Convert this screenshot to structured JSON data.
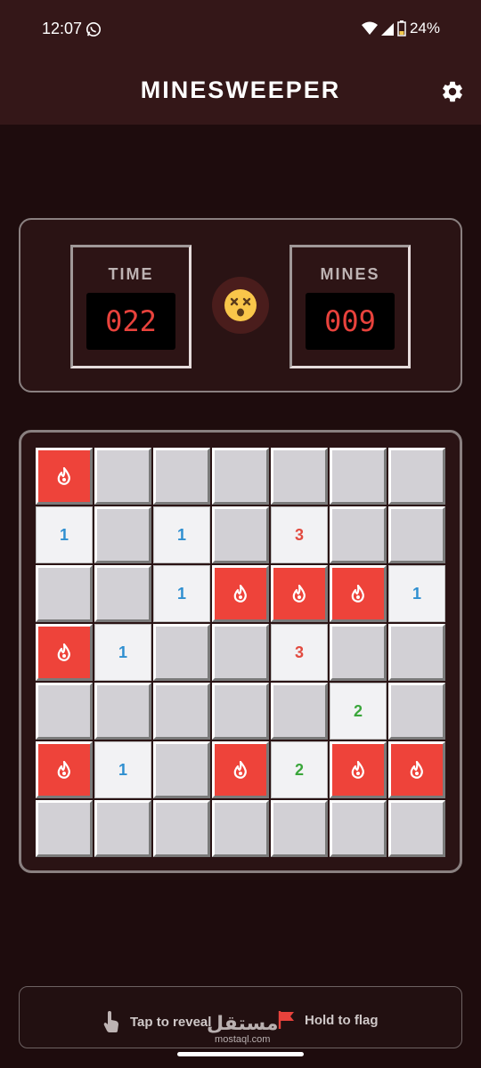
{
  "status_bar": {
    "time": "12:07",
    "battery": "24%"
  },
  "app_bar": {
    "title": "MINESWEEPER"
  },
  "counters": {
    "time_label": "TIME",
    "time_value": "022",
    "mines_label": "MINES",
    "mines_value": "009"
  },
  "board": {
    "columns": 7,
    "rows": [
      [
        {
          "s": "mine"
        },
        {
          "s": "hidden"
        },
        {
          "s": "hidden"
        },
        {
          "s": "hidden"
        },
        {
          "s": "hidden"
        },
        {
          "s": "hidden"
        },
        {
          "s": "hidden"
        }
      ],
      [
        {
          "s": "open",
          "n": "1"
        },
        {
          "s": "hidden"
        },
        {
          "s": "open",
          "n": "1"
        },
        {
          "s": "hidden"
        },
        {
          "s": "open",
          "n": "3"
        },
        {
          "s": "hidden"
        },
        {
          "s": "hidden"
        }
      ],
      [
        {
          "s": "hidden"
        },
        {
          "s": "hidden"
        },
        {
          "s": "open",
          "n": "1"
        },
        {
          "s": "mine"
        },
        {
          "s": "mine"
        },
        {
          "s": "mine"
        },
        {
          "s": "open",
          "n": "1"
        }
      ],
      [
        {
          "s": "mine"
        },
        {
          "s": "open",
          "n": "1"
        },
        {
          "s": "hidden"
        },
        {
          "s": "hidden"
        },
        {
          "s": "open",
          "n": "3"
        },
        {
          "s": "hidden"
        },
        {
          "s": "hidden"
        }
      ],
      [
        {
          "s": "hidden"
        },
        {
          "s": "hidden"
        },
        {
          "s": "hidden"
        },
        {
          "s": "hidden"
        },
        {
          "s": "hidden"
        },
        {
          "s": "open",
          "n": "2"
        },
        {
          "s": "hidden"
        }
      ],
      [
        {
          "s": "mine"
        },
        {
          "s": "open",
          "n": "1"
        },
        {
          "s": "hidden"
        },
        {
          "s": "mine"
        },
        {
          "s": "open",
          "n": "2"
        },
        {
          "s": "mine"
        },
        {
          "s": "mine"
        }
      ],
      [
        {
          "s": "hidden"
        },
        {
          "s": "hidden"
        },
        {
          "s": "hidden"
        },
        {
          "s": "hidden"
        },
        {
          "s": "hidden"
        },
        {
          "s": "hidden"
        },
        {
          "s": "hidden"
        }
      ]
    ]
  },
  "number_colors": {
    "1": "#2f8fd0",
    "2": "#3aa63a",
    "3": "#e24a3f"
  },
  "hints": {
    "reveal": "Tap to reveal",
    "flag": "Hold to flag"
  },
  "watermark": {
    "arabic": "مستقل",
    "latin": "mostaql.com"
  }
}
